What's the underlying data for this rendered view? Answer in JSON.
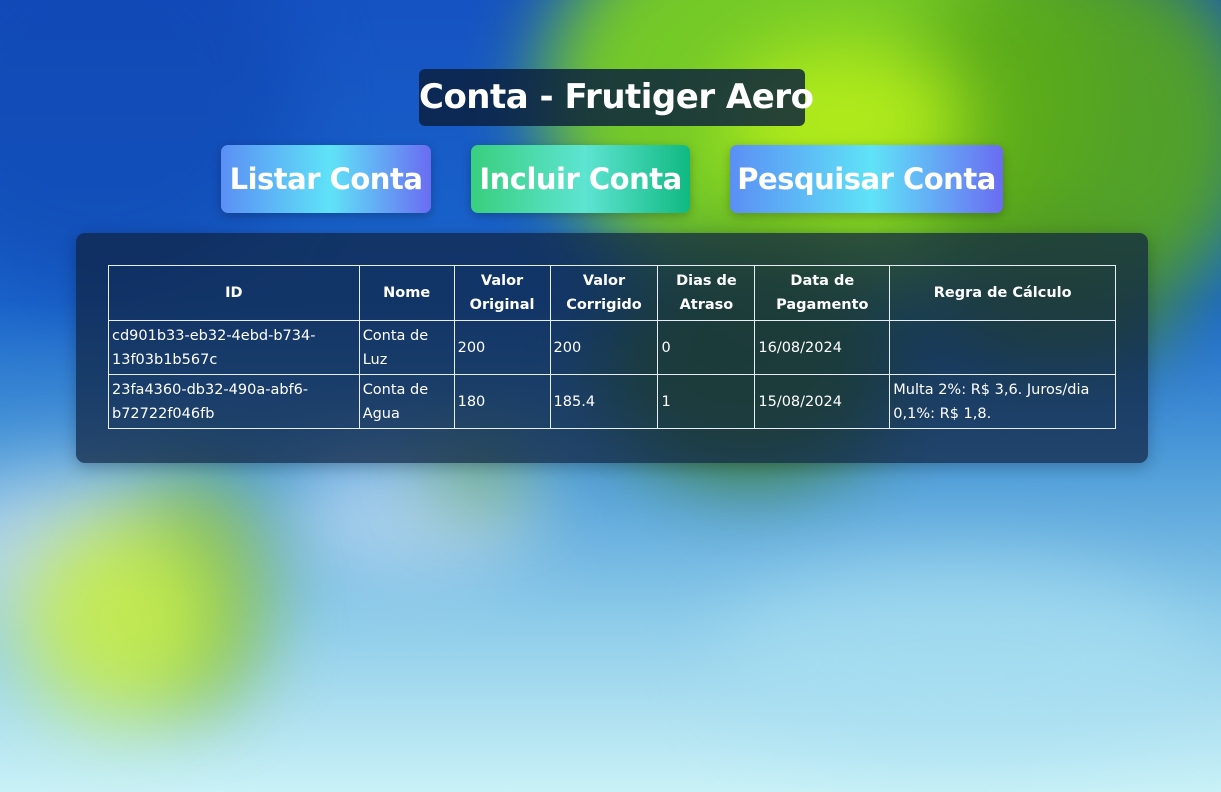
{
  "page": {
    "title": "Conta - Frutiger Aero"
  },
  "actions": {
    "list_label": "Listar Conta",
    "add_label": "Incluir Conta",
    "search_label": "Pesquisar Conta"
  },
  "colors": {
    "title_bg": "#0a1e3c",
    "panel_bg": "#0f2341",
    "list_gradient": [
      "#5b8ff5",
      "#5fe3f7",
      "#6a6cf2"
    ],
    "add_gradient": [
      "#38cf7e",
      "#5ee4d2",
      "#10b981"
    ],
    "text": "#ffffff"
  },
  "table": {
    "headers": [
      "ID",
      "Nome",
      "Valor Original",
      "Valor Corrigido",
      "Dias de Atraso",
      "Data de Pagamento",
      "Regra de Cálculo"
    ],
    "rows": [
      {
        "id": "cd901b33-eb32-4ebd-b734-13f03b1b567c",
        "nome": "Conta de Luz",
        "valor_original": "200",
        "valor_corrigido": "200",
        "dias_atraso": "0",
        "data_pagamento": "16/08/2024",
        "regra": ""
      },
      {
        "id": "23fa4360-db32-490a-abf6-b72722f046fb",
        "nome": "Conta de Agua",
        "valor_original": "180",
        "valor_corrigido": "185.4",
        "dias_atraso": "1",
        "data_pagamento": "15/08/2024",
        "regra": "Multa 2%: R$ 3,6. Juros/dia 0,1%: R$ 1,8."
      }
    ]
  }
}
